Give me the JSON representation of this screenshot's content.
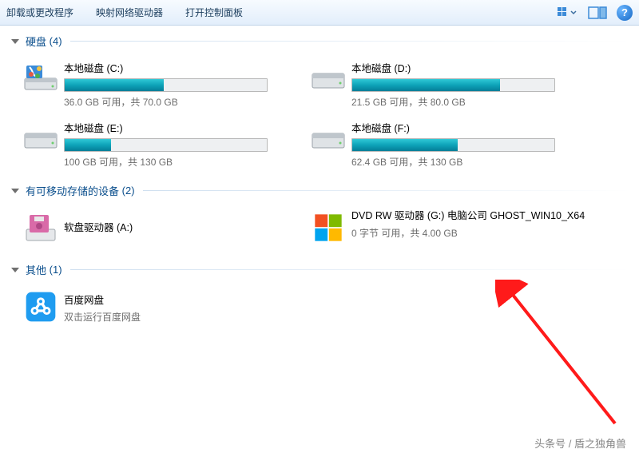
{
  "toolbar": {
    "items": [
      "卸载或更改程序",
      "映射网络驱动器",
      "打开控制面板"
    ]
  },
  "groups": {
    "hdd": {
      "title": "硬盘",
      "count": "(4)"
    },
    "removable": {
      "title": "有可移动存储的设备",
      "count": "(2)"
    },
    "other": {
      "title": "其他",
      "count": "(1)"
    }
  },
  "drives": {
    "c": {
      "name": "本地磁盘 (C:)",
      "info": "36.0 GB 可用，共 70.0 GB",
      "pct": 49
    },
    "d": {
      "name": "本地磁盘 (D:)",
      "info": "21.5 GB 可用，共 80.0 GB",
      "pct": 73
    },
    "e": {
      "name": "本地磁盘 (E:)",
      "info": "100 GB 可用，共 130 GB",
      "pct": 23
    },
    "f": {
      "name": "本地磁盘 (F:)",
      "info": "62.4 GB 可用，共 130 GB",
      "pct": 52
    },
    "a": {
      "name": "软盘驱动器 (A:)"
    },
    "g": {
      "name": "DVD RW 驱动器 (G:) 电脑公司 GHOST_WIN10_X64",
      "info": "0 字节 可用，共 4.00 GB"
    }
  },
  "other_items": {
    "baidu": {
      "name": "百度网盘",
      "sub": "双击运行百度网盘"
    }
  },
  "watermark": "头条号 / 盾之独角兽"
}
